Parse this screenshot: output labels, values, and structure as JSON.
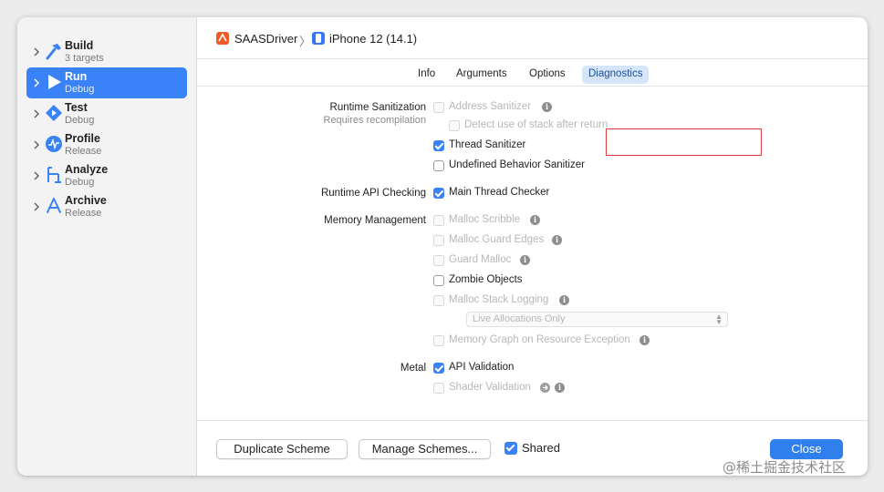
{
  "sidebar": {
    "items": [
      {
        "title": "Build",
        "subtitle": "3 targets"
      },
      {
        "title": "Run",
        "subtitle": "Debug"
      },
      {
        "title": "Test",
        "subtitle": "Debug"
      },
      {
        "title": "Profile",
        "subtitle": "Release"
      },
      {
        "title": "Analyze",
        "subtitle": "Debug"
      },
      {
        "title": "Archive",
        "subtitle": "Release"
      }
    ]
  },
  "header": {
    "scheme": "SAASDriver",
    "separator": "〉",
    "destination": "iPhone 12 (14.1)"
  },
  "tabs": [
    "Info",
    "Arguments",
    "Options",
    "Diagnostics"
  ],
  "sections": {
    "runtime_sanitization": "Runtime Sanitization",
    "requires_recompilation": "Requires recompilation",
    "runtime_api_checking": "Runtime API Checking",
    "memory_management": "Memory Management",
    "metal": "Metal"
  },
  "options": {
    "address_sanitizer": "Address Sanitizer",
    "detect_stack": "Detect use of stack after return",
    "thread_sanitizer": "Thread Sanitizer",
    "ub_sanitizer": "Undefined Behavior Sanitizer",
    "main_thread_checker": "Main Thread Checker",
    "malloc_scribble": "Malloc Scribble",
    "malloc_guard_edges": "Malloc Guard Edges",
    "guard_malloc": "Guard Malloc",
    "zombie_objects": "Zombie Objects",
    "malloc_stack_logging": "Malloc Stack Logging",
    "live_allocations": "Live Allocations Only",
    "memory_graph": "Memory Graph on Resource Exception",
    "api_validation": "API Validation",
    "shader_validation": "Shader Validation"
  },
  "info_glyph": "i",
  "footer": {
    "duplicate": "Duplicate Scheme",
    "manage": "Manage Schemes...",
    "shared": "Shared",
    "close": "Close"
  },
  "watermark": "@稀土掘金技术社区",
  "colors": {
    "accent": "#3a82f7",
    "highlight": "#e23b3b"
  }
}
